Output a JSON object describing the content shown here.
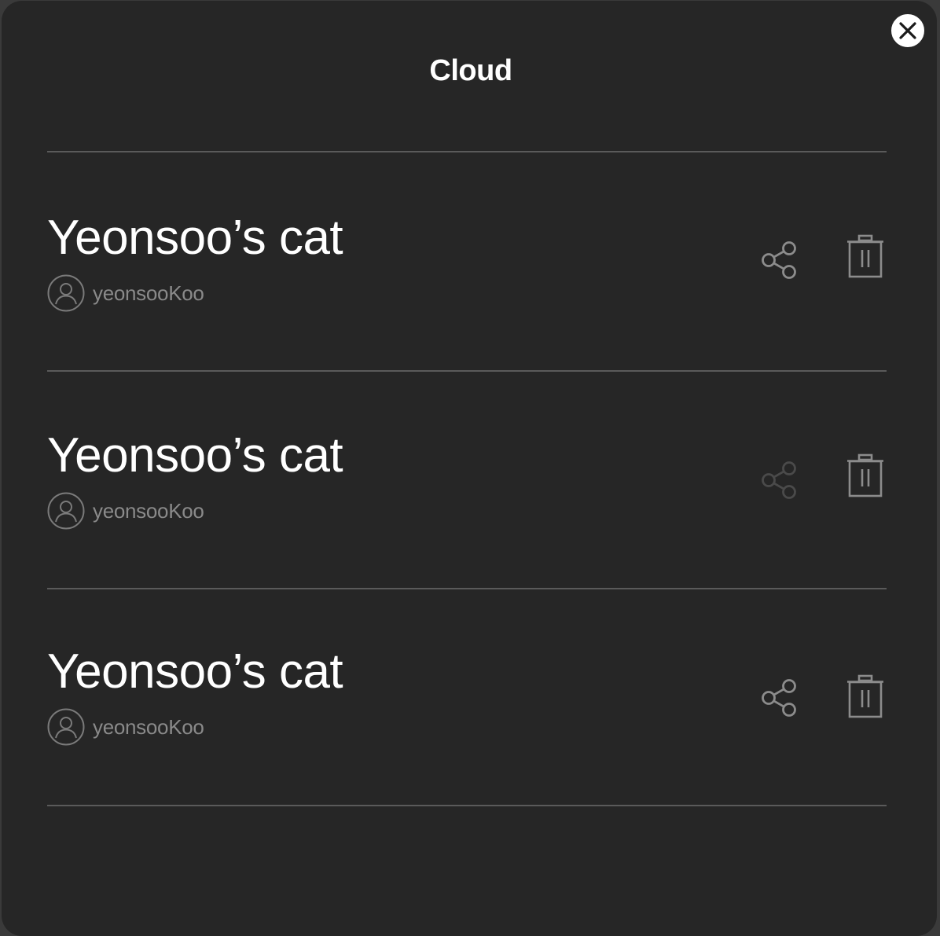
{
  "dialog": {
    "title": "Cloud",
    "close_icon": "close-icon"
  },
  "items": [
    {
      "name": "Yeonsoo’s cat",
      "owner": "yeonsooKoo",
      "share_enabled": true
    },
    {
      "name": "Yeonsoo’s cat",
      "owner": "yeonsooKoo",
      "share_enabled": false
    },
    {
      "name": "Yeonsoo’s cat",
      "owner": "yeonsooKoo",
      "share_enabled": true
    }
  ],
  "icons": {
    "avatar": "user-avatar-icon",
    "share": "share-icon",
    "delete": "trash-icon"
  },
  "colors": {
    "background": "#262626",
    "text": "#ffffff",
    "muted": "#8a8a8a",
    "icon_enabled": "#8c8c8c",
    "icon_disabled": "#4a4a4a",
    "divider": "#5a5a5a"
  }
}
